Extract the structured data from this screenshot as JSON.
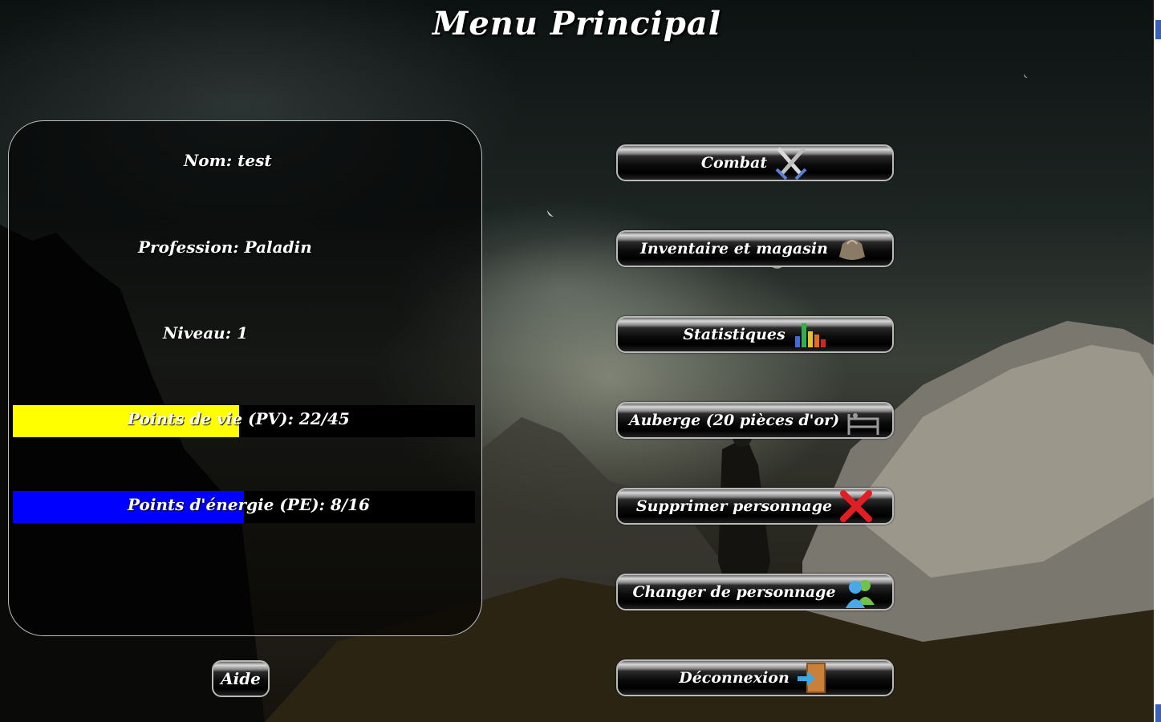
{
  "page": {
    "title": "Menu Principal"
  },
  "character": {
    "name_text": "Nom: test",
    "profession_text": "Profession: Paladin",
    "level_text": "Niveau: 1",
    "hp_text": "Points de vie (PV): 22/45",
    "hp_current": 22,
    "hp_max": 45,
    "hp_color": "#ffff00",
    "ep_text": "Points d'énergie (PE): 8/16",
    "ep_current": 8,
    "ep_max": 16,
    "ep_color": "#0000ff"
  },
  "menu": {
    "combat": {
      "label": "Combat",
      "icon": "crossed-swords-icon"
    },
    "inventory": {
      "label": "Inventaire et magasin",
      "icon": "bag-icon"
    },
    "stats": {
      "label": "Statistiques",
      "icon": "bar-chart-icon"
    },
    "inn": {
      "label": "Auberge (20 pièces d'or)",
      "icon": "bed-icon"
    },
    "delete": {
      "label": "Supprimer personnage",
      "icon": "red-x-icon"
    },
    "switch": {
      "label": "Changer de personnage",
      "icon": "users-icon"
    },
    "logout": {
      "label": "Déconnexion",
      "icon": "exit-door-icon"
    }
  },
  "help": {
    "label": "Aide"
  }
}
